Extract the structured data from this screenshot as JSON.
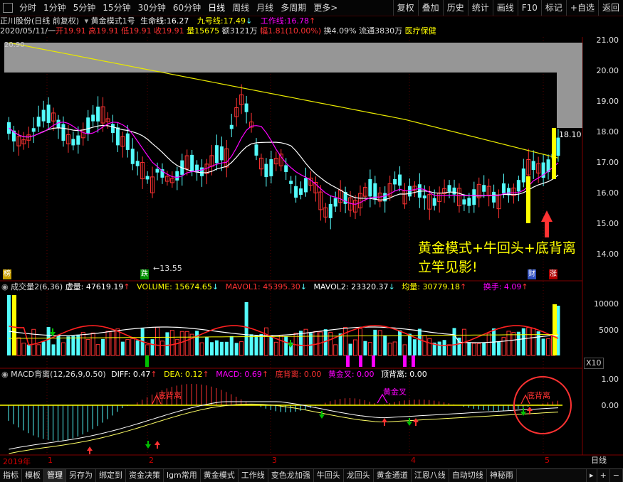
{
  "toolbar": {
    "periods": [
      "分时",
      "1分钟",
      "5分钟",
      "15分钟",
      "30分钟",
      "60分钟",
      "日线",
      "周线",
      "月线",
      "多周期",
      "更多"
    ],
    "active_period": "日线",
    "more_suffix": ">",
    "right_buttons": [
      "复权",
      "叠加",
      "历史",
      "统计",
      "画线",
      "F10",
      "标记",
      "+自选",
      "返回"
    ]
  },
  "header": {
    "stock": "正川股份(日线 前复权)",
    "indicator_name": "黄金模式1号",
    "lifeline_label": "生命线:",
    "lifeline_value": "16.27",
    "nine_label": "九号线:",
    "nine_value": "17.49",
    "nine_arrow": "↓",
    "work_label": "工作线:",
    "work_value": "16.78",
    "work_arrow": "↑"
  },
  "quote": {
    "date": "2020/05/11/一",
    "open": "开19.91",
    "high": "高19.91",
    "low": "低19.91",
    "close": "收19.91",
    "volume": "量15675",
    "amount": "额3121万",
    "change_pct": "幅1.81(10.00%)",
    "turnover": "换4.09%",
    "float": "流通3830万",
    "sector": "医疗保健"
  },
  "main_chart": {
    "y_ticks": [
      "21.00",
      "20.00",
      "19.00",
      "18.00",
      "17.00",
      "16.00",
      "15.00",
      "14.00"
    ],
    "high_label": "20.90",
    "low_label": "←13.55",
    "level_label": "18.10",
    "annotation_line1": "黄金模式+牛回头+底背离",
    "annotation_line2": "立竿见影!",
    "badge_bang": "榜",
    "badge_die": "跌",
    "badge_cai": "财",
    "badge_zhang": "涨"
  },
  "volume_pane": {
    "title": "成交量2(6,36)",
    "virtual": "虚量: 47619.19",
    "volume": "VOLUME: 15674.65",
    "mavol1": "MAVOL1: 45395.30",
    "mavol2": "MAVOL2: 23320.37",
    "avg": "均量: 30779.18",
    "turnover": "换手: 4.09",
    "arrow_up": "↑",
    "arrow_down": "↓",
    "y_ticks": [
      "10000",
      "5000"
    ],
    "unit": "X10"
  },
  "macd_pane": {
    "title": "MACD背离(12,26,9,0.50)",
    "diff": "DIFF: 0.47",
    "dea": "DEA: 0.12",
    "macd": "MACD: 0.69",
    "bottom_div": "底背离: 0.00",
    "golden_cross": "黄金叉: 0.00",
    "top_div": "顶背离: 0.00",
    "arrow_up": "↑",
    "y_ticks": [
      "1.00",
      "0.00"
    ],
    "div_label": "底背离",
    "cross_label": "黄金叉"
  },
  "dates": {
    "year": "2019年",
    "months": [
      "1",
      "2",
      "3",
      "4",
      "5"
    ],
    "period": "日线"
  },
  "bottom_tabs": [
    "指标",
    "模板",
    "管理",
    "另存为",
    "绑定到",
    "资金决策",
    "lgm常用",
    "黄金模式",
    "工作线",
    "变色龙加强",
    "牛回头",
    "龙回头",
    "黄金通道",
    "江恩八线",
    "自动切线",
    "神秘雨"
  ],
  "active_bottom_tab": "管理",
  "colors": {
    "up": "#ff3232",
    "down": "#54fcfc",
    "yellow": "#ffff00",
    "magenta": "#ff00ff",
    "white": "#ffffff",
    "green": "#00c000"
  }
}
